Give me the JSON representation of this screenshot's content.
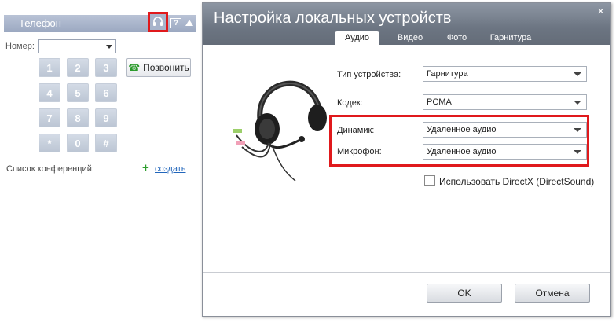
{
  "phone_panel": {
    "title": "Телефон",
    "help_glyph": "?",
    "number_label": "Номер:",
    "number_value": "",
    "keys": [
      "1",
      "2",
      "3",
      "4",
      "5",
      "6",
      "7",
      "8",
      "9",
      "*",
      "0",
      "#"
    ],
    "call_label": "Позвонить",
    "conf_label": "Список конференций:",
    "create_label": "создать",
    "colors": {
      "header": "#9ba8c1",
      "highlight": "#e0191c",
      "link": "#2266bb",
      "plus": "#2e9e2e"
    }
  },
  "dialog": {
    "title": "Настройка локальных устройств",
    "close_glyph": "×",
    "tabs": [
      {
        "label": "Аудио",
        "active": true
      },
      {
        "label": "Видео",
        "active": false
      },
      {
        "label": "Фото",
        "active": false
      },
      {
        "label": "Гарнитура",
        "active": false
      }
    ],
    "fields": {
      "device_type": {
        "label": "Тип устройства:",
        "value": "Гарнитура"
      },
      "codec": {
        "label": "Кодек:",
        "value": "PCMA"
      },
      "speaker": {
        "label": "Динамик:",
        "value": "Удаленное аудио"
      },
      "microphone": {
        "label": "Микрофон:",
        "value": "Удаленное аудио"
      }
    },
    "directx": {
      "label": "Использовать DirectX (DirectSound)",
      "checked": false
    },
    "ok_label": "OK",
    "cancel_label": "Отмена"
  }
}
